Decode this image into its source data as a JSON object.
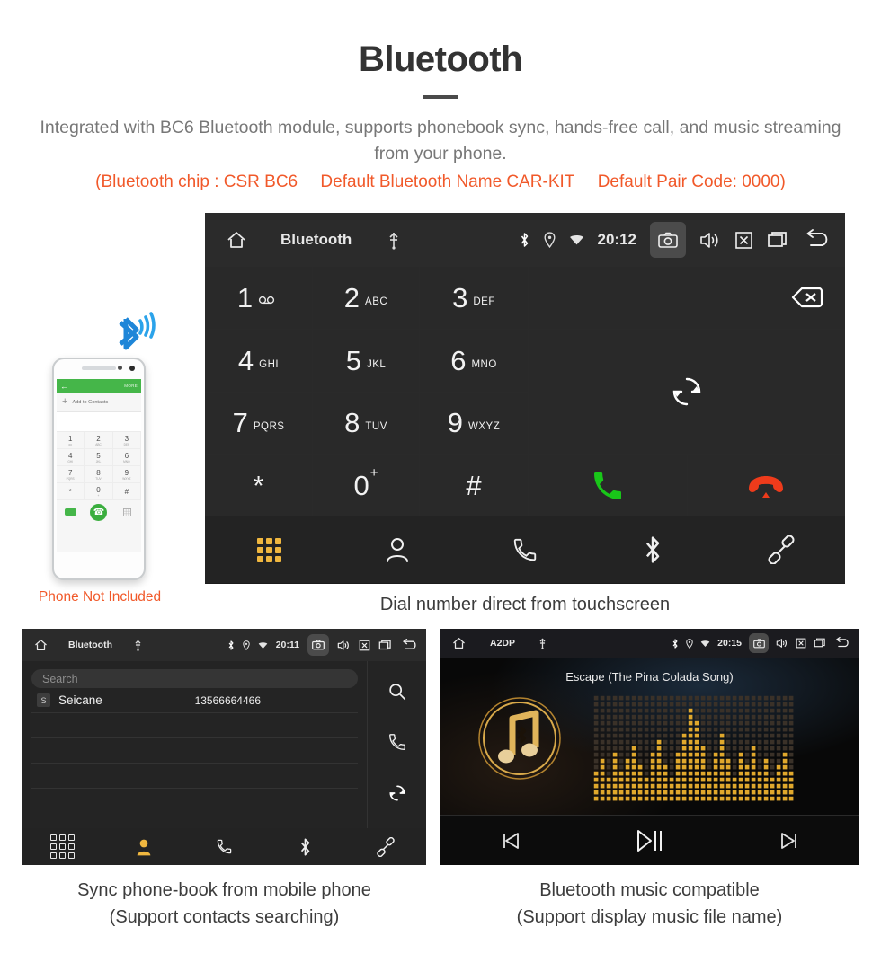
{
  "header": {
    "title": "Bluetooth",
    "subtitle": "Integrated with BC6 Bluetooth module, supports phonebook sync, hands-free call, and music streaming from your phone.",
    "spec_chip": "(Bluetooth chip : CSR BC6",
    "spec_name": "Default Bluetooth Name CAR-KIT",
    "spec_pair": "Default Pair Code: 0000)",
    "accent_color": "#f1592a",
    "subtitle_color": "#777777"
  },
  "dialer": {
    "statusbar": {
      "home_icon": "home-icon",
      "title": "Bluetooth",
      "usb_icon": "usb-icon",
      "bluetooth_icon": "bluetooth-icon",
      "location_icon": "location-icon",
      "wifi_icon": "wifi-icon",
      "time": "20:12",
      "camera_icon": "camera-icon",
      "volume_icon": "volume-icon",
      "close_icon": "close-box-icon",
      "recents_icon": "recents-icon",
      "back_icon": "back-arrow-icon"
    },
    "keys": [
      {
        "num": "1",
        "sub": "",
        "voicemail": true
      },
      {
        "num": "2",
        "sub": "ABC"
      },
      {
        "num": "3",
        "sub": "DEF"
      },
      {
        "num": "4",
        "sub": "GHI"
      },
      {
        "num": "5",
        "sub": "JKL"
      },
      {
        "num": "6",
        "sub": "MNO"
      },
      {
        "num": "7",
        "sub": "PQRS"
      },
      {
        "num": "8",
        "sub": "TUV"
      },
      {
        "num": "9",
        "sub": "WXYZ"
      },
      {
        "num": "*",
        "sub": ""
      },
      {
        "num": "0",
        "sup": "+"
      },
      {
        "num": "#",
        "sub": ""
      }
    ],
    "actions": {
      "delete_icon": "backspace-icon",
      "sync_icon": "sync-icon",
      "call_icon": "call-icon",
      "hangup_icon": "hangup-icon",
      "call_color": "#19c619",
      "hangup_color": "#f0391a"
    },
    "tabs": [
      {
        "icon": "keypad-icon",
        "active": true
      },
      {
        "icon": "contacts-icon",
        "active": false
      },
      {
        "icon": "call-log-icon",
        "active": false
      },
      {
        "icon": "bluetooth-icon",
        "active": false
      },
      {
        "icon": "unlink-icon",
        "active": false
      }
    ],
    "active_tab_color": "#f0b73f",
    "caption": "Dial number direct from touchscreen"
  },
  "phone_mock": {
    "header_back": "back-arrow-icon",
    "header_more": "MORE",
    "add_contacts": "Add to Contacts",
    "keys": [
      {
        "num": "1",
        "sub": "oo"
      },
      {
        "num": "2",
        "sub": "ABC"
      },
      {
        "num": "3",
        "sub": "DEF"
      },
      {
        "num": "4",
        "sub": "GHI"
      },
      {
        "num": "5",
        "sub": "JKL"
      },
      {
        "num": "6",
        "sub": "MNO"
      },
      {
        "num": "7",
        "sub": "PQRS"
      },
      {
        "num": "8",
        "sub": "TUV"
      },
      {
        "num": "9",
        "sub": "WXYZ"
      },
      {
        "num": "*",
        "sub": ""
      },
      {
        "num": "0",
        "sub": "+"
      },
      {
        "num": "#",
        "sub": ""
      }
    ],
    "call_icon": "call-icon",
    "video_icon": "video-call-icon",
    "keyboard_icon": "keyboard-icon",
    "bluetooth_signal_icon": "bluetooth-signal-icon",
    "bluetooth_signal_color": "#1e90e0",
    "disclaimer": "Phone Not Included"
  },
  "phonebook": {
    "statusbar": {
      "home_icon": "home-icon",
      "title": "Bluetooth",
      "usb_icon": "usb-icon",
      "time": "20:11",
      "camera_icon": "camera-icon",
      "volume_icon": "volume-icon",
      "close_icon": "close-box-icon",
      "recents_icon": "recents-icon",
      "back_icon": "back-arrow-icon"
    },
    "search_placeholder": "Search",
    "contacts": [
      {
        "badge": "S",
        "name": "Seicane",
        "number": "13566664466"
      }
    ],
    "rail": [
      {
        "icon": "search-icon"
      },
      {
        "icon": "call-icon"
      },
      {
        "icon": "sync-icon"
      }
    ],
    "tabs": [
      {
        "icon": "keypad-icon",
        "active": false
      },
      {
        "icon": "contacts-icon",
        "active": true
      },
      {
        "icon": "call-log-icon",
        "active": false
      },
      {
        "icon": "bluetooth-icon",
        "active": false
      },
      {
        "icon": "unlink-icon",
        "active": false
      }
    ],
    "caption_line1": "Sync phone-book from mobile phone",
    "caption_line2": "(Support contacts searching)"
  },
  "music": {
    "statusbar": {
      "home_icon": "home-icon",
      "title": "A2DP",
      "usb_icon": "usb-icon",
      "time": "20:15",
      "camera_icon": "camera-icon",
      "volume_icon": "volume-icon",
      "close_icon": "close-box-icon",
      "recents_icon": "recents-icon",
      "back_icon": "back-arrow-icon"
    },
    "track_title": "Escape (The Pina Colada Song)",
    "album_art_icon": "music-note-bluetooth-icon",
    "album_art_color": "#d8a94a",
    "visualizer_icon": "equalizer-visualizer",
    "controls": [
      {
        "icon": "previous-track-icon"
      },
      {
        "icon": "play-pause-icon"
      },
      {
        "icon": "next-track-icon"
      }
    ],
    "caption_line1": "Bluetooth music compatible",
    "caption_line2": "(Support display music file name)"
  }
}
